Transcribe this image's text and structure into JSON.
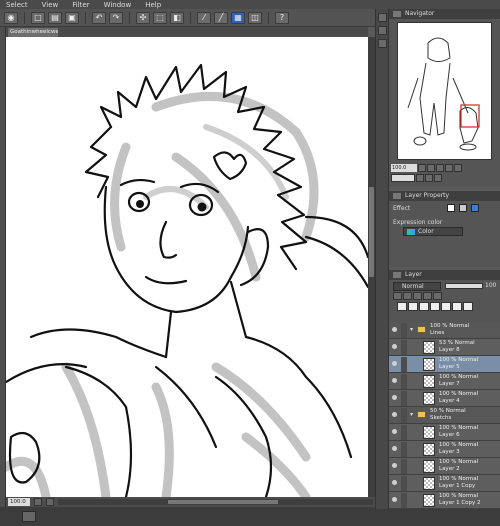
{
  "menu": [
    "Select",
    "View",
    "Filter",
    "Window",
    "Help"
  ],
  "document": {
    "tab": "Goathinwheelcwere"
  },
  "status": {
    "zoom": "100.0"
  },
  "navigator": {
    "title": "Navigator",
    "zoom": "100.0"
  },
  "layer_property": {
    "title": "Layer Property",
    "effect_label": "Effect",
    "expression_label": "Expression color",
    "expression_value": "Color"
  },
  "layer_panel": {
    "title": "Layer",
    "blend_mode": "Normal",
    "opacity": "100"
  },
  "layers": [
    {
      "type": "folder",
      "line1": "100 % Normal",
      "line2": "Lines",
      "selected": false
    },
    {
      "type": "layer",
      "line1": "53 % Normal",
      "line2": "Layer 8",
      "selected": false
    },
    {
      "type": "layer",
      "line1": "100 % Normal",
      "line2": "Layer 5",
      "selected": true
    },
    {
      "type": "layer",
      "line1": "100 % Normal",
      "line2": "Layer 7",
      "selected": false
    },
    {
      "type": "layer",
      "line1": "100 % Normal",
      "line2": "Layer 4",
      "selected": false
    },
    {
      "type": "folder",
      "line1": "50 % Normal",
      "line2": "Sketchs",
      "selected": false
    },
    {
      "type": "layer",
      "line1": "100 % Normal",
      "line2": "Layer 6",
      "selected": false
    },
    {
      "type": "layer",
      "line1": "100 % Normal",
      "line2": "Layer 3",
      "selected": false
    },
    {
      "type": "layer",
      "line1": "100 % Normal",
      "line2": "Layer 2",
      "selected": false
    },
    {
      "type": "layer",
      "line1": "100 % Normal",
      "line2": "Layer 1 Copy",
      "selected": false
    },
    {
      "type": "layer",
      "line1": "100 % Normal",
      "line2": "Layer 1 Copy 2",
      "selected": false
    }
  ],
  "colors": {
    "accent": "#2d63b6",
    "selected_layer": "#7a8fa7",
    "panel_bg": "#555555"
  }
}
